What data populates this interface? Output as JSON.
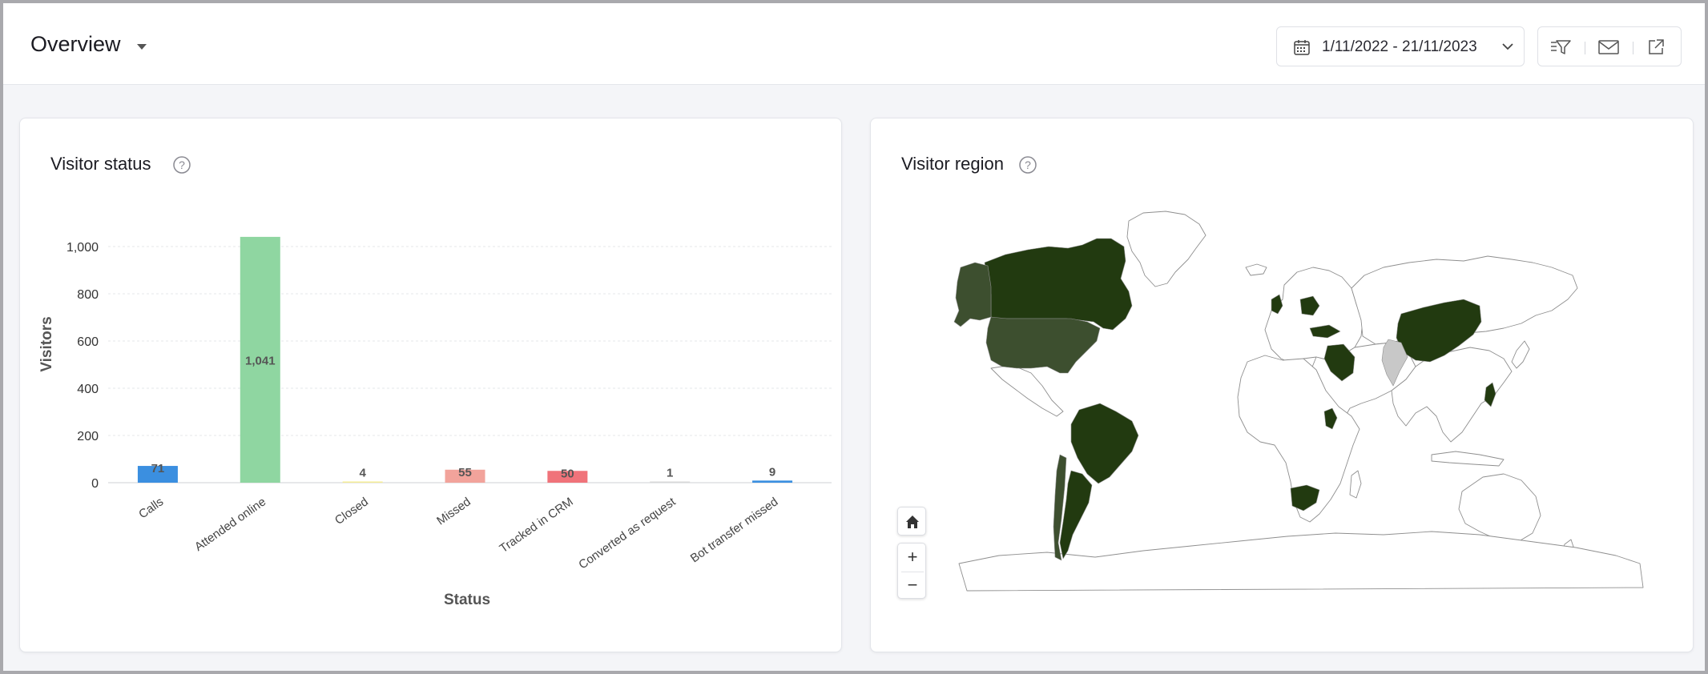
{
  "header": {
    "title": "Overview",
    "date_range": "1/11/2022 - 21/11/2023"
  },
  "visitor_status": {
    "title": "Visitor status"
  },
  "visitor_region": {
    "title": "Visitor region"
  },
  "icons": {
    "title_dropdown": "caret-down-icon",
    "calendar": "calendar-icon",
    "date_dropdown": "chevron-down-icon",
    "filter": "filter-icon",
    "email": "mail-icon",
    "export": "external-link-icon",
    "help": "question-circle-icon",
    "map_home": "home-icon",
    "zoom_in": "plus-icon",
    "zoom_out": "minus-icon"
  },
  "colors": {
    "map_highlight": "#223a10",
    "map_medium": "#3d4f2f",
    "map_grey": "#c8c8c8",
    "gridline": "#e6e7ea"
  },
  "map_controls": {
    "zoom_in": "+",
    "zoom_out": "−"
  },
  "chart_data": {
    "type": "bar",
    "xlabel": "Status",
    "ylabel": "Visitors",
    "ylim": [
      0,
      1100
    ],
    "yticks": [
      0,
      200,
      400,
      600,
      800,
      1000
    ],
    "ytick_labels": [
      "0",
      "200",
      "400",
      "600",
      "800",
      "1,000"
    ],
    "grid": true,
    "categories": [
      "Calls",
      "Attended online",
      "Closed",
      "Missed",
      "Tracked in CRM",
      "Converted as request",
      "Bot transfer missed"
    ],
    "values": [
      71,
      1041,
      4,
      55,
      50,
      1,
      9
    ],
    "value_labels": [
      "71",
      "1,041",
      "4",
      "55",
      "50",
      "1",
      "9"
    ],
    "colors": [
      "#3b8fe0",
      "#8fd6a1",
      "#f4ec96",
      "#f2a39b",
      "#f0737a",
      "#d8d8d8",
      "#3b8fe0"
    ]
  }
}
